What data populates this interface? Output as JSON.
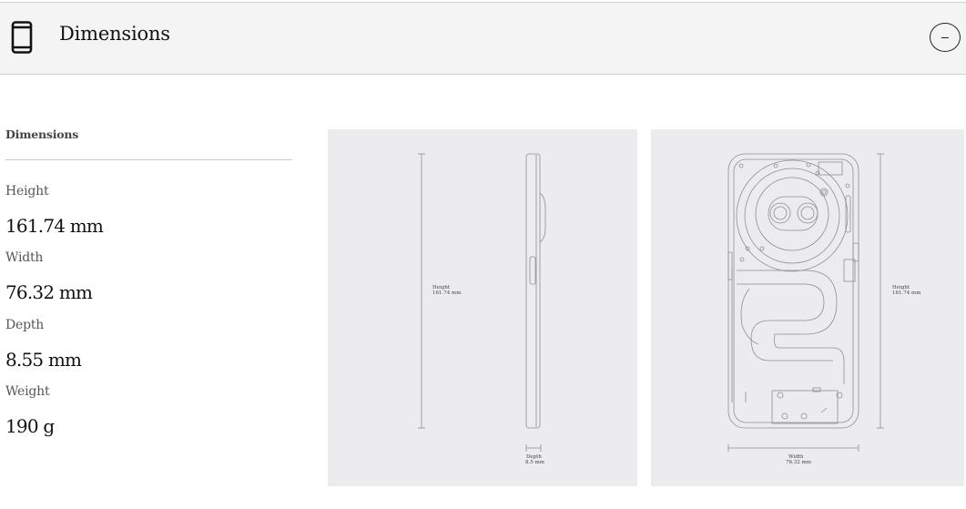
{
  "header": {
    "title": "Dimensions",
    "icon": "phone-icon",
    "toggle_icon": "minus-icon"
  },
  "specs": {
    "heading": "Dimensions",
    "items": [
      {
        "label": "Height",
        "value": "161.74 mm"
      },
      {
        "label": "Width",
        "value": "76.32 mm"
      },
      {
        "label": "Depth",
        "value": "8.55 mm"
      },
      {
        "label": "Weight",
        "value": "190 g"
      }
    ]
  },
  "figures": {
    "side": {
      "height_label": "Height",
      "height_value": "161.74 mm",
      "depth_label": "Depth",
      "depth_value": "8.5 mm"
    },
    "back": {
      "height_label": "Height",
      "height_value": "161.74 mm",
      "width_label": "Width",
      "width_value": "76.32 mm"
    }
  },
  "colors": {
    "header_bg": "#f4f4f4",
    "figure_bg": "#ececee",
    "line": "#9a9a9a"
  }
}
